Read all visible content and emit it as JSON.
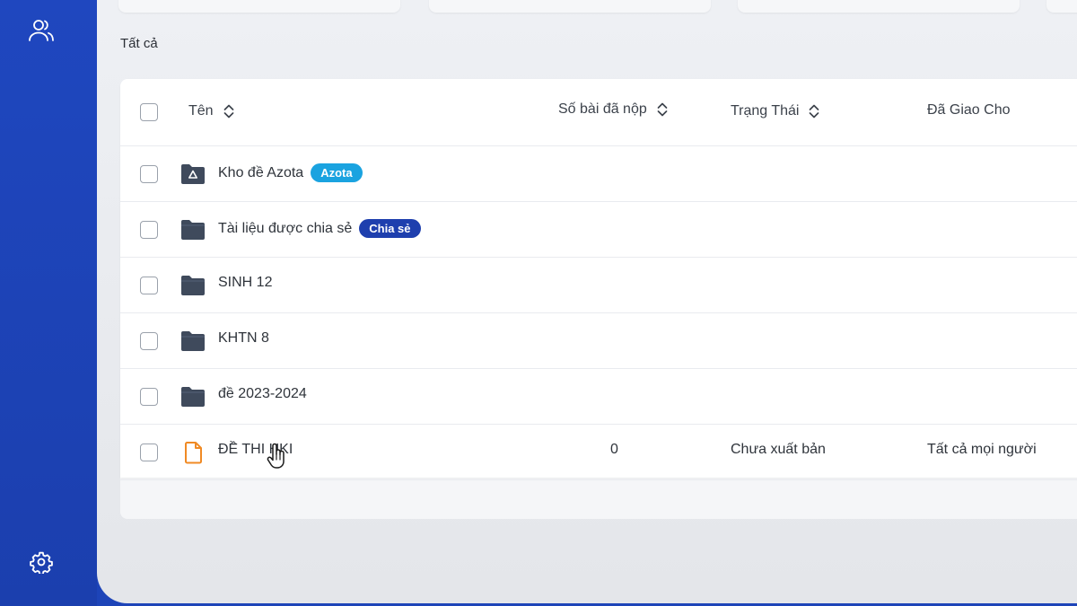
{
  "section_title": "Tất cả",
  "table": {
    "columns": {
      "name": "Tên",
      "submitted": "Số bài đã nộp",
      "status": "Trạng Thái",
      "assigned": "Đã Giao Cho"
    },
    "rows": [
      {
        "name": "Kho đề Azota",
        "badge": "Azota",
        "type": "folder-special"
      },
      {
        "name": "Tài liệu được chia sẻ",
        "badge": "Chia sẻ",
        "type": "folder"
      },
      {
        "name": "SINH 12",
        "type": "folder"
      },
      {
        "name": "KHTN 8",
        "type": "folder"
      },
      {
        "name": "đề 2023-2024",
        "type": "folder"
      },
      {
        "name": "ĐỀ THI HKI",
        "type": "document",
        "submitted": "0",
        "status": "Chưa xuất bản",
        "assigned": "Tất cả mọi người"
      }
    ]
  },
  "colors": {
    "sidebar": "#1d44b8",
    "azota_badge": "#1aa3e0",
    "share_badge": "#1e3fae",
    "folder": "#3f4a5c",
    "document": "#f08a24"
  },
  "icons": [
    "users-icon",
    "settings-gear-icon",
    "folder-icon",
    "azota-folder-icon",
    "document-icon",
    "sort-icon",
    "hand-cursor-icon"
  ]
}
